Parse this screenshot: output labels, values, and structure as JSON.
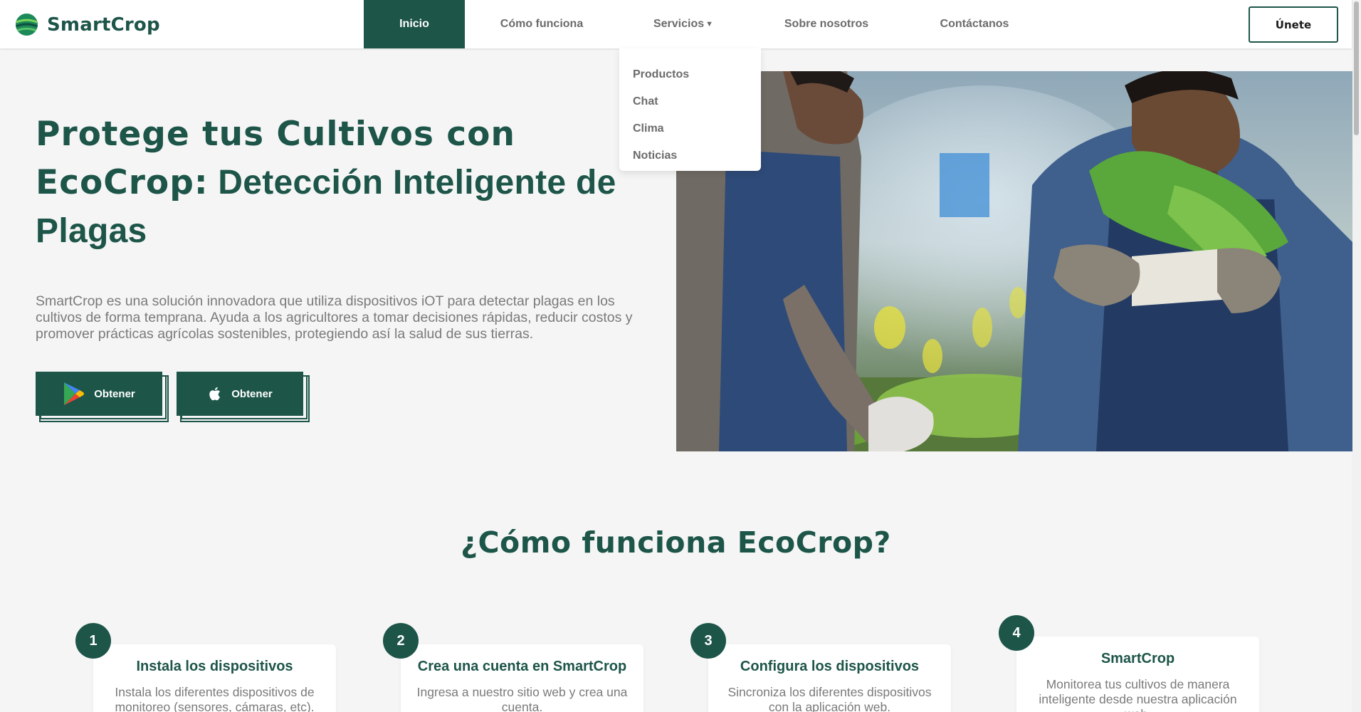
{
  "brand": {
    "name": "SmartCrop"
  },
  "nav": {
    "items": [
      {
        "label": "Inicio",
        "active": true
      },
      {
        "label": "Cómo funciona",
        "active": false
      },
      {
        "label": "Servicios",
        "active": false,
        "has_caret": true
      },
      {
        "label": "Sobre nosotros",
        "active": false
      },
      {
        "label": "Contáctanos",
        "active": false
      }
    ],
    "join_label": "Únete"
  },
  "dropdown": {
    "items": [
      "Productos",
      "Chat",
      "Clima",
      "Noticias"
    ]
  },
  "hero": {
    "title_strong_1": "Protege tus Cultivos con",
    "title_strong_2": "EcoCrop:",
    "title_light_2": " Detección Inteligente de",
    "title_light_3": "Plagas",
    "description": "SmartCrop es una solución innovadora que utiliza dispositivos iOT para detectar plagas en los cultivos de forma temprana. Ayuda a los agricultores a tomar decisiones rápidas, reducir costos y promover prácticas agrícolas sostenibles, protegiendo así la salud de sus tierras.",
    "buttons": [
      {
        "label": "Obtener",
        "icon": "google-play-icon"
      },
      {
        "label": "Obtener",
        "icon": "apple-icon"
      }
    ]
  },
  "how_it_works": {
    "title": "¿Cómo funciona EcoCrop?",
    "steps": [
      {
        "number": "1",
        "title": "Instala los dispositivos",
        "description": "Instala los diferentes dispositivos de monitoreo (sensores, cámaras, etc)."
      },
      {
        "number": "2",
        "title": "Crea una cuenta en SmartCrop",
        "description": "Ingresa a nuestro sitio web y crea una cuenta."
      },
      {
        "number": "3",
        "title": "Configura los dispositivos",
        "description": "Sincroniza los diferentes dispositivos con la aplicación web."
      },
      {
        "number": "4",
        "title": "SmartCrop",
        "description": "Monitorea tus cultivos de manera inteligente desde nuestra aplicación web."
      }
    ]
  },
  "colors": {
    "primary": "#1d5549",
    "text_muted": "#7a7a7a",
    "nav_text": "#6b6b6b",
    "background": "#f5f5f5"
  }
}
